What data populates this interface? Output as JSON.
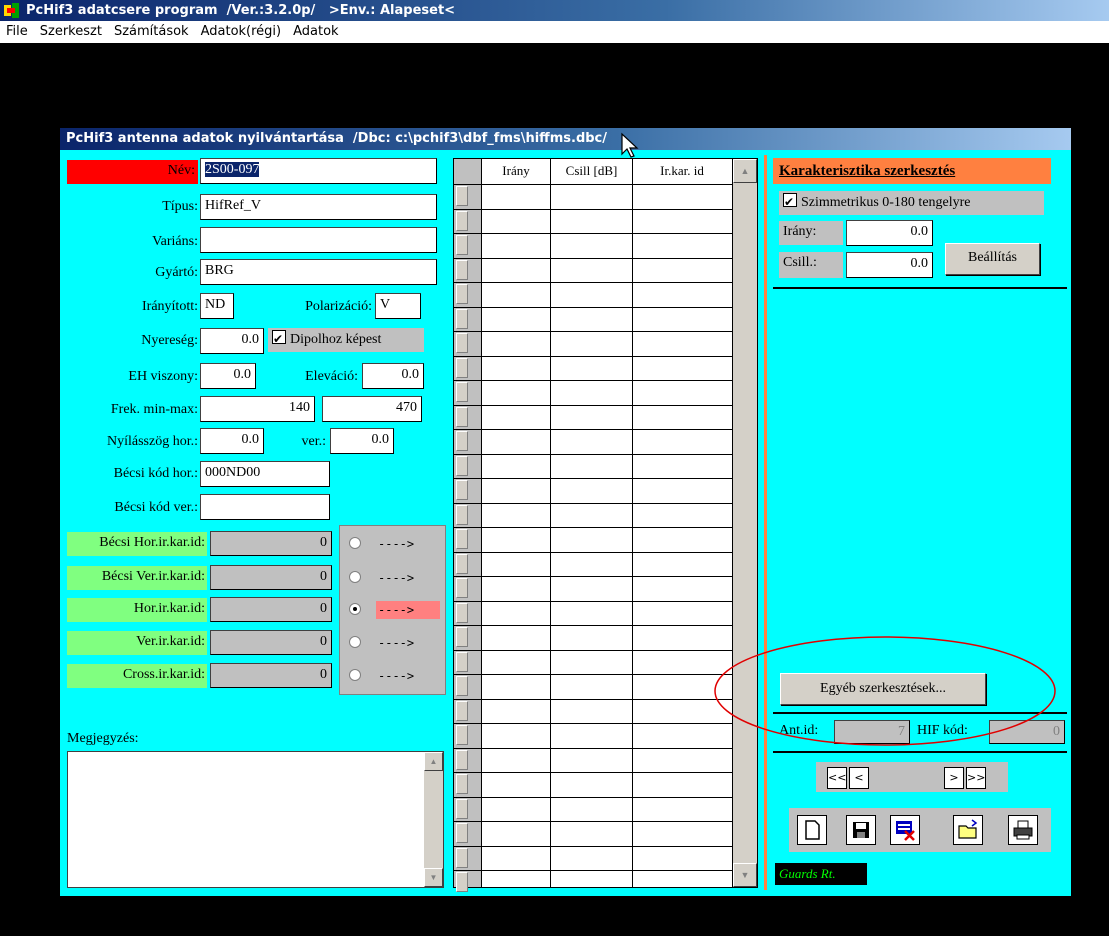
{
  "app": {
    "title": "PcHif3 adatcsere program  /Ver.:3.2.0p/   >Env.: Alapeset<"
  },
  "menu": [
    "File",
    "Szerkeszt",
    "Számítások",
    "Adatok(régi)",
    "Adatok"
  ],
  "window": {
    "title": "PcHif3 antenna adatok nyilvántartása  /Dbc: c:\\pchif3\\dbf_fms\\hiffms.dbc/"
  },
  "form": {
    "nev_label": "Név:",
    "nev": "2S00-097",
    "tipus_label": "Típus:",
    "tipus": "HifRef_V",
    "varians_label": "Variáns:",
    "varians": "",
    "gyarto_label": "Gyártó:",
    "gyarto": "BRG",
    "iranyitott_label": "Irányított:",
    "iranyitott": "ND",
    "polarizacio_label": "Polarizáció:",
    "polarizacio": "V",
    "nyereseg_label": "Nyereség:",
    "nyereseg": "0.0",
    "dipol_label": "Dipolhoz képest",
    "eh_label": "EH viszony:",
    "eh": "0.0",
    "elevacio_label": "Eleváció:",
    "elevacio": "0.0",
    "frek_label": "Frek. min-max:",
    "frek_min": "140",
    "frek_max": "470",
    "nyilas_label": "Nyílásszög hor.:",
    "nyilas_hor": "0.0",
    "ver_label": "ver.:",
    "nyilas_ver": "0.0",
    "becsi_hor_label": "Bécsi kód hor.:",
    "becsi_hor": "000ND00",
    "becsi_ver_label": "Bécsi kód ver.:",
    "becsi_ver": ""
  },
  "karids": [
    {
      "label": "Bécsi Hor.ir.kar.id:",
      "value": "0",
      "selected": false
    },
    {
      "label": "Bécsi Ver.ir.kar.id:",
      "value": "0",
      "selected": false
    },
    {
      "label": "Hor.ir.kar.id:",
      "value": "0",
      "selected": true
    },
    {
      "label": "Ver.ir.kar.id:",
      "value": "0",
      "selected": false
    },
    {
      "label": "Cross.ir.kar.id:",
      "value": "0",
      "selected": false
    }
  ],
  "arrow_text": "---->",
  "megjegyzes_label": "Megjegyzés:",
  "table": {
    "headers": [
      "Irány",
      "Csill [dB]",
      "Ir.kar. id"
    ]
  },
  "right": {
    "header": "Karakterisztika szerkesztés",
    "szimmetrikus": "Szimmetrikus 0-180 tengelyre",
    "irany_label": "Irány:",
    "irany": "0.0",
    "csill_label": "Csill.:",
    "csill": "0.0",
    "beallitas": "Beállítás",
    "egyeb": "Egyéb szerkesztések...",
    "antid_label": "Ant.id:",
    "antid": "7",
    "hif_label": "HIF kód:",
    "hif": "0",
    "nav": [
      "<<",
      "<",
      ">",
      ">>"
    ],
    "guards": "Guards Rt."
  },
  "colors": {
    "window_bg": "#00ffff",
    "nev_bg": "#ff0000",
    "green": "#80ff80",
    "selected_arrow": "#ff8080",
    "header_orange": "#ff8040",
    "annotation": "#e00000"
  }
}
